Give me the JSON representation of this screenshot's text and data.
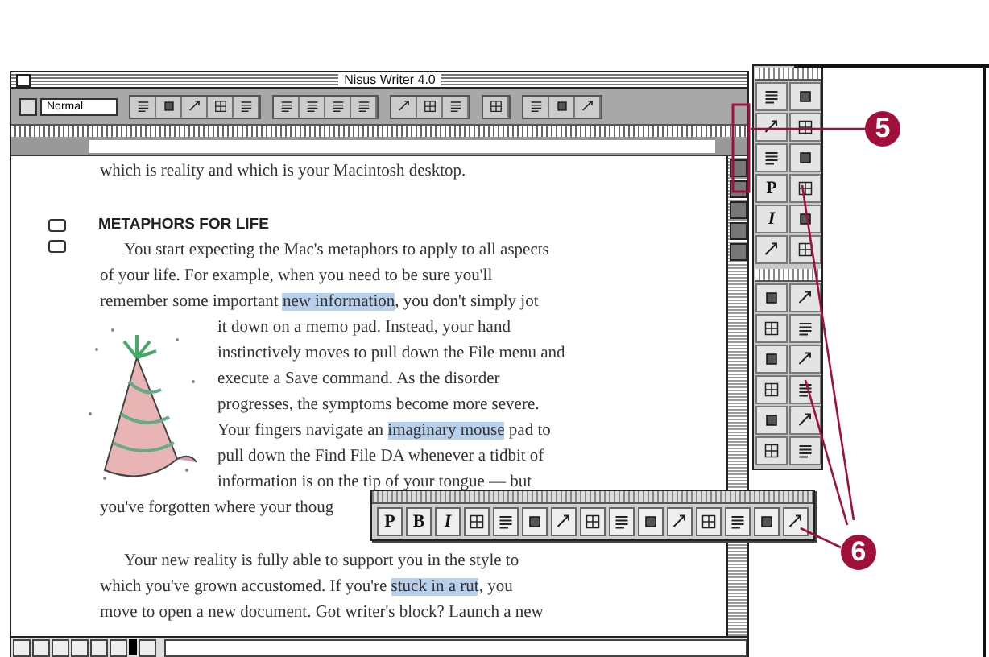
{
  "window": {
    "title": "Nisus Writer 4.0"
  },
  "toolbar": {
    "style_field": "Normal"
  },
  "document": {
    "lines_above": [
      [
        {
          "text": "which is reality and which is your Macintosh desktop.",
          "highlighted": false
        }
      ]
    ],
    "heading": "METAPHORS FOR LIFE",
    "paragraphs": [
      {
        "lines": [
          [
            {
              "text": "You start expecting the Mac's metaphors to apply to all aspects",
              "highlighted": false
            }
          ],
          [
            {
              "text": "of your life. For example, when you need to be sure you'll",
              "highlighted": false
            }
          ],
          [
            {
              "text": "remember some important ",
              "highlighted": false
            },
            {
              "text": "new information",
              "highlighted": true
            },
            {
              "text": ", you don't simply jot",
              "highlighted": false
            }
          ]
        ],
        "beside_picture": [
          [
            {
              "text": "it down on a memo pad. Instead, your hand",
              "highlighted": false
            }
          ],
          [
            {
              "text": "instinctively moves to pull down the File menu and",
              "highlighted": false
            }
          ],
          [
            {
              "text": "execute a Save command. As the disorder",
              "highlighted": false
            }
          ],
          [
            {
              "text": "progresses, the symptoms become more severe.",
              "highlighted": false
            }
          ],
          [
            {
              "text": "Your fingers navigate an ",
              "highlighted": false
            },
            {
              "text": "imaginary mouse",
              "highlighted": true
            },
            {
              "text": " pad to",
              "highlighted": false
            }
          ],
          [
            {
              "text": "pull down the Find File DA whenever a tidbit of",
              "highlighted": false
            }
          ],
          [
            {
              "text": "information is on the tip of your tongue — but",
              "highlighted": false
            }
          ]
        ],
        "after": [
          [
            {
              "text": "you've forgotten where your thoug",
              "highlighted": false
            }
          ]
        ]
      },
      {
        "lines": [
          [
            {
              "text": "Your new reality is fully able to support you in the style to",
              "highlighted": false
            }
          ],
          [
            {
              "text": "which you've grown accustomed. If you're ",
              "highlighted": false
            },
            {
              "text": "stuck in a rut",
              "highlighted": true
            },
            {
              "text": ", you",
              "highlighted": false
            }
          ],
          [
            {
              "text": "move to open a new document. Got writer's block? Launch a new",
              "highlighted": false
            }
          ]
        ]
      }
    ]
  },
  "tool_palette": {
    "sections": [
      {
        "tools": [
          {
            "kind": "icon"
          },
          {
            "kind": "icon"
          },
          {
            "kind": "icon"
          },
          {
            "kind": "icon"
          },
          {
            "kind": "icon"
          },
          {
            "kind": "icon"
          },
          {
            "kind": "glyph",
            "label": "P"
          },
          {
            "kind": "icon"
          },
          {
            "kind": "glyph",
            "label": "I"
          },
          {
            "kind": "icon"
          },
          {
            "kind": "icon"
          },
          {
            "kind": "icon"
          }
        ]
      },
      {
        "tools": [
          {
            "kind": "icon"
          },
          {
            "kind": "icon"
          },
          {
            "kind": "icon"
          },
          {
            "kind": "icon"
          },
          {
            "kind": "icon"
          },
          {
            "kind": "icon"
          },
          {
            "kind": "icon"
          },
          {
            "kind": "icon"
          },
          {
            "kind": "icon"
          },
          {
            "kind": "icon"
          },
          {
            "kind": "icon"
          },
          {
            "kind": "icon"
          }
        ]
      }
    ]
  },
  "floating_palette": {
    "tools": [
      {
        "kind": "glyph",
        "label": "P"
      },
      {
        "kind": "glyph",
        "label": "B"
      },
      {
        "kind": "glyph",
        "label": "I"
      },
      {
        "kind": "icon"
      },
      {
        "kind": "icon"
      },
      {
        "kind": "icon"
      },
      {
        "kind": "icon"
      },
      {
        "kind": "icon"
      },
      {
        "kind": "icon"
      },
      {
        "kind": "icon"
      },
      {
        "kind": "icon"
      },
      {
        "kind": "icon"
      },
      {
        "kind": "icon"
      },
      {
        "kind": "icon"
      },
      {
        "kind": "icon"
      }
    ]
  },
  "callouts": [
    {
      "number": "5"
    },
    {
      "number": "6"
    }
  ]
}
